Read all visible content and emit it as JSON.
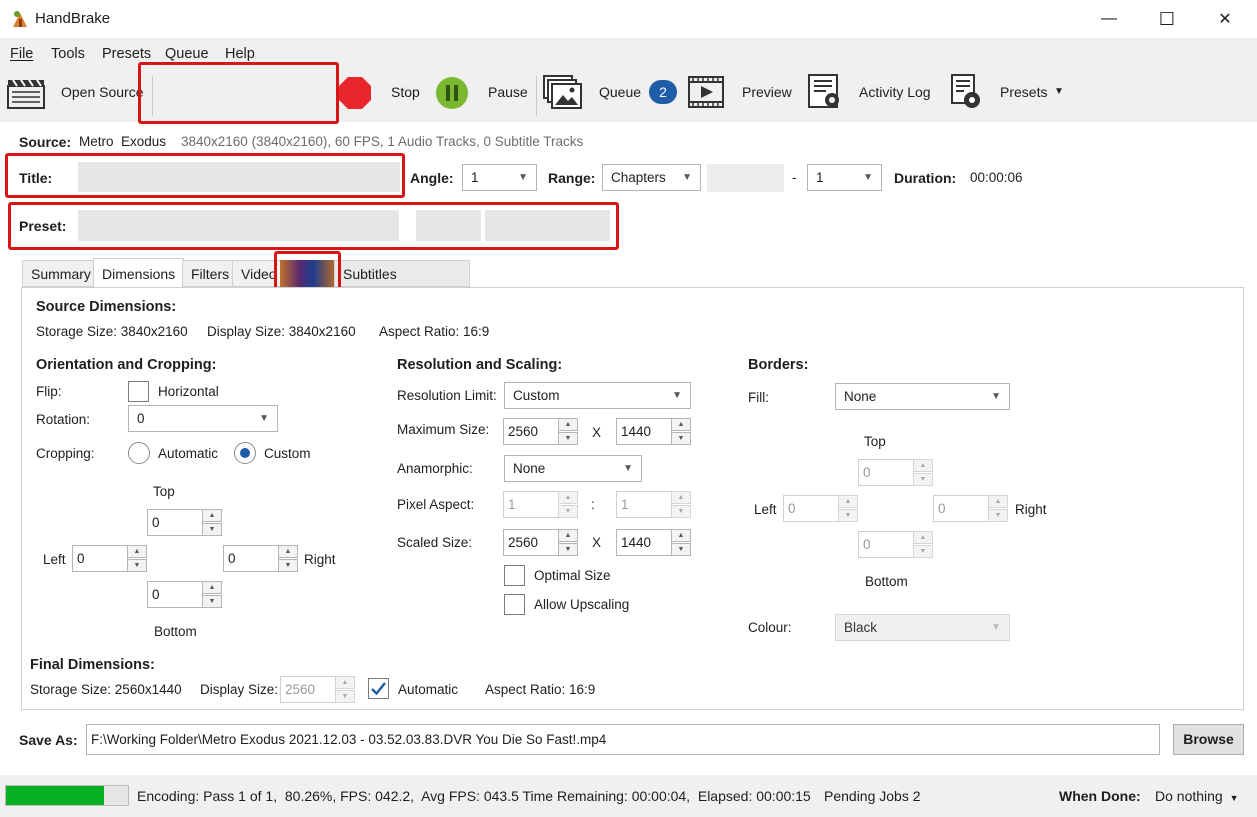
{
  "window": {
    "title": "HandBrake",
    "minimize_glyph": "—",
    "maximize_glyph": "☐",
    "close_glyph": "✕"
  },
  "menu": [
    "File",
    "Tools",
    "Presets",
    "Queue",
    "Help"
  ],
  "toolbar": {
    "open_source": "Open Source",
    "stop": "Stop",
    "pause": "Pause",
    "queue": "Queue",
    "queue_count": "2",
    "preview": "Preview",
    "activity_log": "Activity Log",
    "presets": "Presets"
  },
  "source": {
    "label": "Source:",
    "name": "Metro  Exodus",
    "details": "3840x2160 (3840x2160), 60 FPS, 1 Audio Tracks, 0 Subtitle Tracks"
  },
  "title_row": {
    "title_label": "Title:",
    "angle_label": "Angle:",
    "angle_value": "1",
    "range_label": "Range:",
    "range_value": "Chapters",
    "range_dash": "-",
    "range_end": "1",
    "duration_label": "Duration:",
    "duration_value": "00:00:06"
  },
  "preset_row": {
    "label": "Preset:"
  },
  "tabs": [
    "Summary",
    "Dimensions",
    "Filters",
    "Video",
    "Subtitles"
  ],
  "source_dimensions": {
    "heading": "Source Dimensions:",
    "storage": "Storage Size: 3840x2160",
    "display": "Display Size: 3840x2160",
    "aspect": "Aspect Ratio: 16:9"
  },
  "orientation": {
    "heading": "Orientation and Cropping:",
    "flip_label": "Flip:",
    "flip_option": "Horizontal",
    "rotation_label": "Rotation:",
    "rotation_value": "0",
    "cropping_label": "Cropping:",
    "crop_automatic": "Automatic",
    "crop_custom": "Custom",
    "top_label": "Top",
    "top": "0",
    "left_label": "Left",
    "left": "0",
    "right": "0",
    "right_label": "Right",
    "bottom": "0",
    "bottom_label": "Bottom"
  },
  "resolution": {
    "heading": "Resolution and Scaling:",
    "limit_label": "Resolution Limit:",
    "limit_value": "Custom",
    "max_label": "Maximum Size:",
    "max_w": "2560",
    "max_h": "1440",
    "x": "X",
    "anamorphic_label": "Anamorphic:",
    "anamorphic_value": "None",
    "pixel_label": "Pixel Aspect:",
    "pixel_w": "1",
    "pixel_sep": ":",
    "pixel_h": "1",
    "scaled_label": "Scaled Size:",
    "scaled_w": "2560",
    "scaled_h": "1440",
    "optimal": "Optimal Size",
    "upscaling": "Allow Upscaling"
  },
  "borders": {
    "heading": "Borders:",
    "fill_label": "Fill:",
    "fill_value": "None",
    "top_label": "Top",
    "top": "0",
    "left_label": "Left",
    "left": "0",
    "right": "0",
    "right_label": "Right",
    "bottom": "0",
    "bottom_label": "Bottom",
    "colour_label": "Colour:",
    "colour_value": "Black"
  },
  "final_dimensions": {
    "heading": "Final Dimensions:",
    "storage": "Storage Size: 2560x1440",
    "display_label": "Display Size:",
    "display_value": "2560",
    "automatic": "Automatic",
    "aspect": "Aspect Ratio: 16:9"
  },
  "save_as": {
    "label": "Save As:",
    "path": "F:\\Working Folder\\Metro Exodus 2021.12.03 - 03.52.03.83.DVR You Die So Fast!.mp4",
    "browse": "Browse"
  },
  "status": {
    "progress": 0.8026,
    "text": "Encoding: Pass 1 of 1,  80.26%, FPS: 042.2,  Avg FPS: 043.5 Time Remaining: 00:00:04,  Elapsed: 00:00:15",
    "pending": "Pending Jobs 2",
    "when_done_label": "When Done:",
    "when_done_value": "Do nothing"
  },
  "colors": {
    "accent": "#1f5da8",
    "progress": "#06b025",
    "highlight": "#d81414",
    "badge": "#1f5da8"
  }
}
